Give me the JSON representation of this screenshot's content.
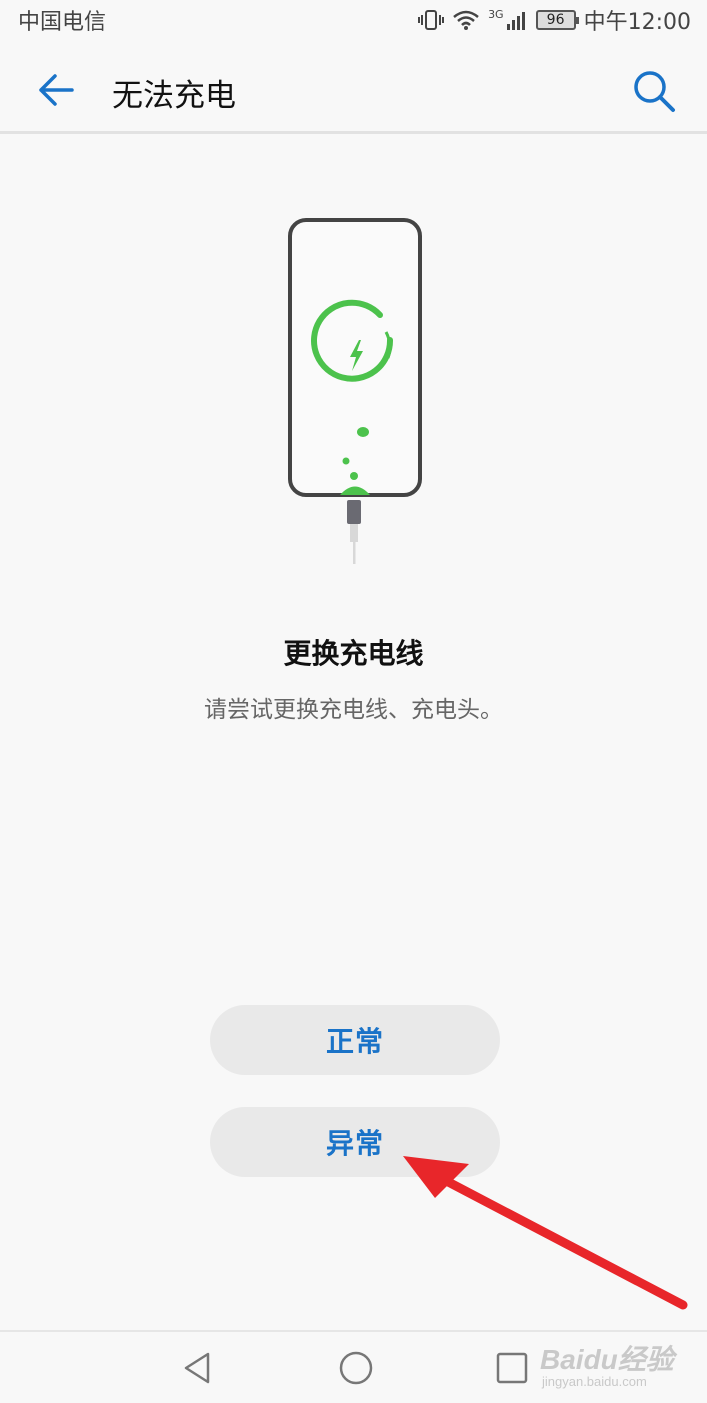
{
  "status_bar": {
    "carrier": "中国电信",
    "network": "3G",
    "battery": "96",
    "time": "中午12:00"
  },
  "app_bar": {
    "title": "无法充电",
    "back_icon": "arrow-left-icon",
    "search_icon": "search-icon"
  },
  "tip": {
    "title": "更换充电线",
    "description": "请尝试更换充电线、充电头。"
  },
  "buttons": {
    "normal": "正常",
    "abnormal": "异常"
  },
  "colors": {
    "accent": "#1a73c8",
    "charge_green": "#4cc24c",
    "annotation_red": "#e8262a"
  },
  "watermark": {
    "main": "Baidu经验",
    "sub": "jingyan.baidu.com"
  }
}
